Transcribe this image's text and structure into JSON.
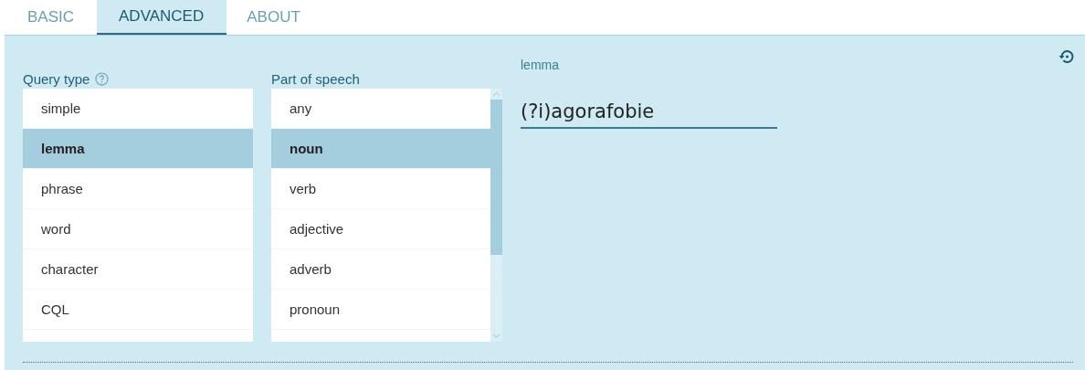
{
  "tabs": [
    {
      "label": "BASIC",
      "selected": false
    },
    {
      "label": "ADVANCED",
      "selected": true
    },
    {
      "label": "ABOUT",
      "selected": false
    }
  ],
  "query_type": {
    "label": "Query type",
    "items": [
      {
        "label": "simple",
        "selected": false
      },
      {
        "label": "lemma",
        "selected": true
      },
      {
        "label": "phrase",
        "selected": false
      },
      {
        "label": "word",
        "selected": false
      },
      {
        "label": "character",
        "selected": false
      },
      {
        "label": "CQL",
        "selected": false
      }
    ]
  },
  "part_of_speech": {
    "label": "Part of speech",
    "items": [
      {
        "label": "any",
        "selected": false
      },
      {
        "label": "noun",
        "selected": true
      },
      {
        "label": "verb",
        "selected": false
      },
      {
        "label": "adjective",
        "selected": false
      },
      {
        "label": "adverb",
        "selected": false
      },
      {
        "label": "pronoun",
        "selected": false
      }
    ]
  },
  "lemma_field": {
    "label": "lemma",
    "value": "(?i)agorafobie"
  }
}
